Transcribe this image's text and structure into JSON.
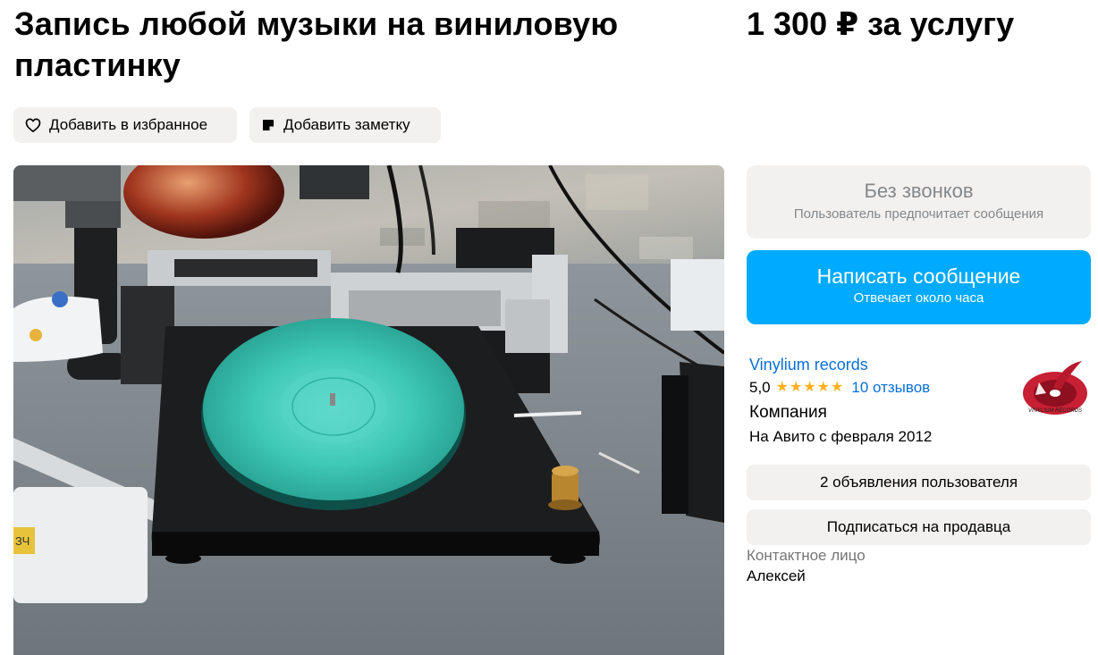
{
  "listing": {
    "title": "Запись любой музыки на виниловую пластинку",
    "price": "1 300 ₽ за услугу"
  },
  "actions": {
    "favorite_label": "Добавить в избранное",
    "note_label": "Добавить заметку"
  },
  "contact_panel": {
    "no_calls_title": "Без звонков",
    "no_calls_subtitle": "Пользователь предпочитает сообщения",
    "message_button_label": "Написать сообщение",
    "message_button_subtitle": "Отвечает около часа"
  },
  "seller": {
    "name": "Vinylium records",
    "rating": "5,0",
    "stars": "★★★★★",
    "reviews": "10 отзывов",
    "type": "Компания",
    "since": "На Авито с февраля 2012",
    "logo_text": "VINYLIUM RECORDS",
    "ads_button": "2 объявления пользователя",
    "subscribe_button": "Подписаться на продавца",
    "contact_label": "Контактное лицо",
    "contact_name": "Алексей"
  },
  "photo": {
    "box_text": "ЗЧ"
  },
  "colors": {
    "accent_blue": "#00aaff",
    "link_blue": "#0a6fd8",
    "star_yellow": "#ffb021",
    "chip_bg": "#f2f1f0",
    "vinyl": "#3fc9b6"
  },
  "icons": {
    "favorite": "heart-icon",
    "note": "note-icon"
  }
}
